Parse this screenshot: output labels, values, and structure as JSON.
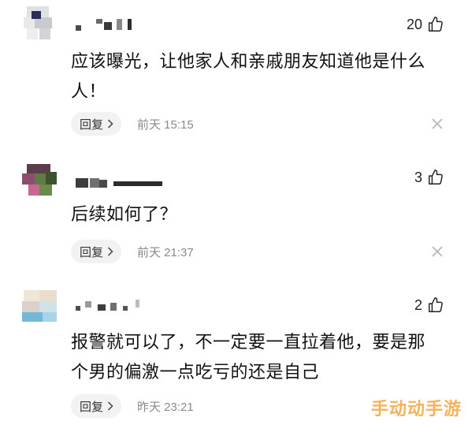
{
  "comments": [
    {
      "likes": "20",
      "text": "应该曝光，让他家人和亲戚朋友知道他是什么人！",
      "reply_label": "回复",
      "time": "前天 15:15"
    },
    {
      "likes": "3",
      "text": "后续如何了？",
      "reply_label": "回复",
      "time": "前天 21:37"
    },
    {
      "likes": "2",
      "text": "报警就可以了，不一定要一直拉着他，要是那个男的偏激一点吃亏的还是自己",
      "reply_label": "回复",
      "time": "昨天 23:21"
    }
  ],
  "watermark": "手动动手游",
  "icons": {
    "like": "thumbs-up-outline-icon",
    "reply_chevron": "chevron-right-icon",
    "close": "close-icon"
  },
  "colors": {
    "reply_bg": "#f2f2f2",
    "time": "#8a8a8a",
    "close": "#b5b5b5",
    "watermark": "#f4b25a"
  }
}
